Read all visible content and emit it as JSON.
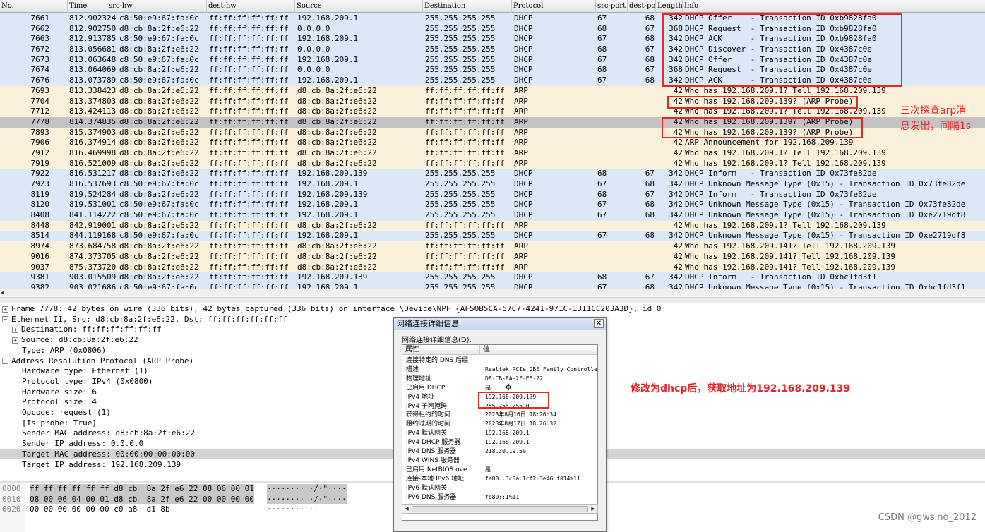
{
  "packet_list": {
    "columns": [
      "No.",
      "Time",
      "src-hw",
      "dest-hw",
      "Source",
      "Destination",
      "Protocol",
      "src-port",
      "dest-po",
      "Length",
      "Info"
    ],
    "rows": [
      {
        "no": "7661",
        "time": "812.902324",
        "srchw": "c8:50:e9:67:fa:0c",
        "dsthw": "ff:ff:ff:ff:ff:ff",
        "src": "192.168.209.1",
        "dst": "255.255.255.255",
        "proto": "DHCP",
        "sport": "67",
        "dport": "68",
        "len": "342",
        "info": "DHCP Offer    - Transaction ID 0xb9828fa0",
        "color": "blue"
      },
      {
        "no": "7662",
        "time": "812.902750",
        "srchw": "d8:cb:8a:2f:e6:22",
        "dsthw": "ff:ff:ff:ff:ff:ff",
        "src": "0.0.0.0",
        "dst": "255.255.255.255",
        "proto": "DHCP",
        "sport": "68",
        "dport": "67",
        "len": "368",
        "info": "DHCP Request  - Transaction ID 0xb9828fa0",
        "color": "blue"
      },
      {
        "no": "7663",
        "time": "812.913785",
        "srchw": "c8:50:e9:67:fa:0c",
        "dsthw": "ff:ff:ff:ff:ff:ff",
        "src": "192.168.209.1",
        "dst": "255.255.255.255",
        "proto": "DHCP",
        "sport": "67",
        "dport": "68",
        "len": "342",
        "info": "DHCP ACK      - Transaction ID 0xb9828fa0",
        "color": "blue"
      },
      {
        "no": "7672",
        "time": "813.056681",
        "srchw": "d8:cb:8a:2f:e6:22",
        "dsthw": "ff:ff:ff:ff:ff:ff",
        "src": "0.0.0.0",
        "dst": "255.255.255.255",
        "proto": "DHCP",
        "sport": "68",
        "dport": "67",
        "len": "342",
        "info": "DHCP Discover - Transaction ID 0x4387c0e",
        "color": "blue"
      },
      {
        "no": "7673",
        "time": "813.063648",
        "srchw": "c8:50:e9:67:fa:0c",
        "dsthw": "ff:ff:ff:ff:ff:ff",
        "src": "192.168.209.1",
        "dst": "255.255.255.255",
        "proto": "DHCP",
        "sport": "67",
        "dport": "68",
        "len": "342",
        "info": "DHCP Offer    - Transaction ID 0x4387c0e",
        "color": "blue"
      },
      {
        "no": "7674",
        "time": "813.064069",
        "srchw": "d8:cb:8a:2f:e6:22",
        "dsthw": "ff:ff:ff:ff:ff:ff",
        "src": "0.0.0.0",
        "dst": "255.255.255.255",
        "proto": "DHCP",
        "sport": "68",
        "dport": "67",
        "len": "368",
        "info": "DHCP Request  - Transaction ID 0x4387c0e",
        "color": "blue"
      },
      {
        "no": "7676",
        "time": "813.073789",
        "srchw": "c8:50:e9:67:fa:0c",
        "dsthw": "ff:ff:ff:ff:ff:ff",
        "src": "192.168.209.1",
        "dst": "255.255.255.255",
        "proto": "DHCP",
        "sport": "67",
        "dport": "68",
        "len": "342",
        "info": "DHCP ACK      - Transaction ID 0x4387c0e",
        "color": "blue"
      },
      {
        "no": "7693",
        "time": "813.338423",
        "srchw": "d8:cb:8a:2f:e6:22",
        "dsthw": "ff:ff:ff:ff:ff:ff",
        "src": "d8:cb:8a:2f:e6:22",
        "dst": "ff:ff:ff:ff:ff:ff",
        "proto": "ARP",
        "sport": "",
        "dport": "",
        "len": "42",
        "info": "Who has 192.168.209.1? Tell 192.168.209.139",
        "color": "tan"
      },
      {
        "no": "7704",
        "time": "813.374803",
        "srchw": "d8:cb:8a:2f:e6:22",
        "dsthw": "ff:ff:ff:ff:ff:ff",
        "src": "d8:cb:8a:2f:e6:22",
        "dst": "ff:ff:ff:ff:ff:ff",
        "proto": "ARP",
        "sport": "",
        "dport": "",
        "len": "42",
        "info": "Who has 192.168.209.139? (ARP Probe)",
        "color": "tan"
      },
      {
        "no": "7712",
        "time": "813.424113",
        "srchw": "d8:cb:8a:2f:e6:22",
        "dsthw": "ff:ff:ff:ff:ff:ff",
        "src": "d8:cb:8a:2f:e6:22",
        "dst": "ff:ff:ff:ff:ff:ff",
        "proto": "ARP",
        "sport": "",
        "dport": "",
        "len": "42",
        "info": "Who has 192.168.209.1? Tell 192.168.209.139",
        "color": "tan"
      },
      {
        "no": "7778",
        "time": "814.374835",
        "srchw": "d8:cb:8a:2f:e6:22",
        "dsthw": "ff:ff:ff:ff:ff:ff",
        "src": "d8:cb:8a:2f:e6:22",
        "dst": "ff:ff:ff:ff:ff:ff",
        "proto": "ARP",
        "sport": "",
        "dport": "",
        "len": "42",
        "info": "Who has 192.168.209.139? (ARP Probe)",
        "color": "sel"
      },
      {
        "no": "7893",
        "time": "815.374903",
        "srchw": "d8:cb:8a:2f:e6:22",
        "dsthw": "ff:ff:ff:ff:ff:ff",
        "src": "d8:cb:8a:2f:e6:22",
        "dst": "ff:ff:ff:ff:ff:ff",
        "proto": "ARP",
        "sport": "",
        "dport": "",
        "len": "42",
        "info": "Who has 192.168.209.139? (ARP Probe)",
        "color": "tan"
      },
      {
        "no": "7906",
        "time": "816.374914",
        "srchw": "d8:cb:8a:2f:e6:22",
        "dsthw": "ff:ff:ff:ff:ff:ff",
        "src": "d8:cb:8a:2f:e6:22",
        "dst": "ff:ff:ff:ff:ff:ff",
        "proto": "ARP",
        "sport": "",
        "dport": "",
        "len": "42",
        "info": "ARP Announcement for 192.168.209.139",
        "color": "tan"
      },
      {
        "no": "7912",
        "time": "816.469998",
        "srchw": "d8:cb:8a:2f:e6:22",
        "dsthw": "ff:ff:ff:ff:ff:ff",
        "src": "d8:cb:8a:2f:e6:22",
        "dst": "ff:ff:ff:ff:ff:ff",
        "proto": "ARP",
        "sport": "",
        "dport": "",
        "len": "42",
        "info": "Who has 192.168.209.1? Tell 192.168.209.139",
        "color": "tan"
      },
      {
        "no": "7919",
        "time": "816.521009",
        "srchw": "d8:cb:8a:2f:e6:22",
        "dsthw": "ff:ff:ff:ff:ff:ff",
        "src": "d8:cb:8a:2f:e6:22",
        "dst": "ff:ff:ff:ff:ff:ff",
        "proto": "ARP",
        "sport": "",
        "dport": "",
        "len": "42",
        "info": "Who has 192.168.209.1? Tell 192.168.209.139",
        "color": "tan"
      },
      {
        "no": "7922",
        "time": "816.531217",
        "srchw": "d8:cb:8a:2f:e6:22",
        "dsthw": "ff:ff:ff:ff:ff:ff",
        "src": "192.168.209.139",
        "dst": "255.255.255.255",
        "proto": "DHCP",
        "sport": "68",
        "dport": "67",
        "len": "342",
        "info": "DHCP Inform   - Transaction ID 0x73fe82de",
        "color": "blue"
      },
      {
        "no": "7923",
        "time": "816.537693",
        "srchw": "c8:50:e9:67:fa:0c",
        "dsthw": "ff:ff:ff:ff:ff:ff",
        "src": "192.168.209.1",
        "dst": "255.255.255.255",
        "proto": "DHCP",
        "sport": "67",
        "dport": "68",
        "len": "342",
        "info": "DHCP Unknown Message Type (0x15) - Transaction ID 0x73fe82de",
        "color": "blue"
      },
      {
        "no": "8119",
        "time": "819.524284",
        "srchw": "d8:cb:8a:2f:e6:22",
        "dsthw": "ff:ff:ff:ff:ff:ff",
        "src": "192.168.209.139",
        "dst": "255.255.255.255",
        "proto": "DHCP",
        "sport": "68",
        "dport": "67",
        "len": "342",
        "info": "DHCP Inform   - Transaction ID 0x73fe82de",
        "color": "blue"
      },
      {
        "no": "8120",
        "time": "819.531001",
        "srchw": "c8:50:e9:67:fa:0c",
        "dsthw": "ff:ff:ff:ff:ff:ff",
        "src": "192.168.209.1",
        "dst": "255.255.255.255",
        "proto": "DHCP",
        "sport": "67",
        "dport": "68",
        "len": "342",
        "info": "DHCP Unknown Message Type (0x15) - Transaction ID 0x73fe82de",
        "color": "blue"
      },
      {
        "no": "8408",
        "time": "841.114222",
        "srchw": "c8:50:e9:67:fa:0c",
        "dsthw": "ff:ff:ff:ff:ff:ff",
        "src": "192.168.209.1",
        "dst": "255.255.255.255",
        "proto": "DHCP",
        "sport": "67",
        "dport": "68",
        "len": "342",
        "info": "DHCP Unknown Message Type (0x15) - Transaction ID 0xe2719df8",
        "color": "blue"
      },
      {
        "no": "8448",
        "time": "842.919001",
        "srchw": "d8:cb:8a:2f:e6:22",
        "dsthw": "ff:ff:ff:ff:ff:ff",
        "src": "d8:cb:8a:2f:e6:22",
        "dst": "ff:ff:ff:ff:ff:ff",
        "proto": "ARP",
        "sport": "",
        "dport": "",
        "len": "42",
        "info": "Who has 192.168.209.1? Tell 192.168.209.139",
        "color": "tan"
      },
      {
        "no": "8514",
        "time": "844.119168",
        "srchw": "c8:50:e9:67:fa:0c",
        "dsthw": "ff:ff:ff:ff:ff:ff",
        "src": "192.168.209.1",
        "dst": "255.255.255.255",
        "proto": "DHCP",
        "sport": "67",
        "dport": "68",
        "len": "342",
        "info": "DHCP Unknown Message Type (0x15) - Transaction ID 0xe2719df8",
        "color": "blue"
      },
      {
        "no": "8974",
        "time": "873.684758",
        "srchw": "d8:cb:8a:2f:e6:22",
        "dsthw": "ff:ff:ff:ff:ff:ff",
        "src": "d8:cb:8a:2f:e6:22",
        "dst": "ff:ff:ff:ff:ff:ff",
        "proto": "ARP",
        "sport": "",
        "dport": "",
        "len": "42",
        "info": "Who has 192.168.209.141? Tell 192.168.209.139",
        "color": "tan"
      },
      {
        "no": "9016",
        "time": "874.373705",
        "srchw": "d8:cb:8a:2f:e6:22",
        "dsthw": "ff:ff:ff:ff:ff:ff",
        "src": "d8:cb:8a:2f:e6:22",
        "dst": "ff:ff:ff:ff:ff:ff",
        "proto": "ARP",
        "sport": "",
        "dport": "",
        "len": "42",
        "info": "Who has 192.168.209.141? Tell 192.168.209.139",
        "color": "tan"
      },
      {
        "no": "9037",
        "time": "875.373720",
        "srchw": "d8:cb:8a:2f:e6:22",
        "dsthw": "ff:ff:ff:ff:ff:ff",
        "src": "d8:cb:8a:2f:e6:22",
        "dst": "ff:ff:ff:ff:ff:ff",
        "proto": "ARP",
        "sport": "",
        "dport": "",
        "len": "42",
        "info": "Who has 192.168.209.141? Tell 192.168.209.139",
        "color": "tan"
      },
      {
        "no": "9381",
        "time": "903.015509",
        "srchw": "d8:cb:8a:2f:e6:22",
        "dsthw": "ff:ff:ff:ff:ff:ff",
        "src": "192.168.209.139",
        "dst": "255.255.255.255",
        "proto": "DHCP",
        "sport": "68",
        "dport": "67",
        "len": "342",
        "info": "DHCP Inform   - Transaction ID 0xbc1fd3f1",
        "color": "blue"
      },
      {
        "no": "9382",
        "time": "903.021686",
        "srchw": "c8:50:e9:67:fa:0c",
        "dsthw": "ff:ff:ff:ff:ff:ff",
        "src": "192.168.209.1",
        "dst": "255.255.255.255",
        "proto": "DHCP",
        "sport": "67",
        "dport": "68",
        "len": "342",
        "info": "DHCP Unknown Message Type (0x15) - Transaction ID 0xbc1fd3f1",
        "color": "blue"
      }
    ]
  },
  "details": {
    "frame": "Frame 7778: 42 bytes on wire (336 bits), 42 bytes captured (336 bits) on interface \\Device\\NPF_{AF50B5CA-57C7-4241-971C-1311CC203A3D}, id 0",
    "ethernet": "Ethernet II, Src: d8:cb:8a:2f:e6:22, Dst: ff:ff:ff:ff:ff:ff",
    "eth_dest": "Destination: ff:ff:ff:ff:ff:ff",
    "eth_src": "Source: d8:cb:8a:2f:e6:22",
    "eth_type": "Type: ARP (0x0806)",
    "arp": "Address Resolution Protocol (ARP Probe)",
    "arp_fields": [
      "Hardware type: Ethernet (1)",
      "Protocol type: IPv4 (0x0800)",
      "Hardware size: 6",
      "Protocol size: 4",
      "Opcode: request (1)",
      "[Is probe: True]",
      "Sender MAC address: d8:cb:8a:2f:e6:22",
      "Sender IP address: 0.0.0.0",
      "Target MAC address: 00:00:00:00:00:00",
      "Target IP address: 192.168.209.139"
    ]
  },
  "bytes": [
    {
      "offset": "0000",
      "hex": "ff ff ff ff ff ff d8 cb  8a 2f e6 22 08 06 00 01",
      "ascii": "········ ·/·\"····"
    },
    {
      "offset": "0010",
      "hex": "08 00 06 04 00 01 d8 cb  8a 2f e6 22 00 00 00 00",
      "ascii": "········ ·/·\"····"
    },
    {
      "offset": "0020",
      "hex": "00 00 00 00 00 00 c0 a8  d1 8b",
      "ascii": "········ ··"
    }
  ],
  "dialog": {
    "title": "网络连接详细信息",
    "close": "✕",
    "caption": "网络连接详细信息(D):",
    "col_prop": "属性",
    "col_val": "值",
    "rows": [
      {
        "k": "连接特定的 DNS 后缀",
        "v": ""
      },
      {
        "k": "描述",
        "v": "Realtek PCIe GBE Family Controller"
      },
      {
        "k": "物理地址",
        "v": "D8-CB-8A-2F-E6-22"
      },
      {
        "k": "已启用 DHCP",
        "v": "是"
      },
      {
        "k": "IPv4 地址",
        "v": "192.168.209.139"
      },
      {
        "k": "IPv4 子网掩码",
        "v": "255.255.255.0"
      },
      {
        "k": "获得租约的时间",
        "v": "2023年8月16日 18:26:34"
      },
      {
        "k": "租约过期的时间",
        "v": "2023年8月17日 18:26:32"
      },
      {
        "k": "IPv4 默认网关",
        "v": "192.168.209.1"
      },
      {
        "k": "IPv4 DHCP 服务器",
        "v": "192.168.209.1"
      },
      {
        "k": "IPv4 DNS 服务器",
        "v": "218.30.19.50"
      },
      {
        "k": "IPv4 WINS 服务器",
        "v": ""
      },
      {
        "k": "已启用 NetBIOS ove...",
        "v": "是"
      },
      {
        "k": "连接-本地 IPv6 地址",
        "v": "fe80::3c0a:1cf2:3e46:f014%11"
      },
      {
        "k": "IPv6 默认网关",
        "v": ""
      },
      {
        "k": "IPv6 DNS 服务器",
        "v": "fe80::1%11"
      }
    ]
  },
  "annotations": {
    "arp_note_line1": "三次探查arp消",
    "arp_note_line2": "息发出，间隔1s",
    "dhcp_note": "修改为dhcp后，获取地址为192.168.209.139",
    "color": "#e8262a"
  },
  "watermark": "CSDN @gwsino_2012",
  "colors": {
    "dhcp_row": "#dae8f7",
    "arp_row": "#fbf0da",
    "selected_row": "#c3c3c3"
  }
}
